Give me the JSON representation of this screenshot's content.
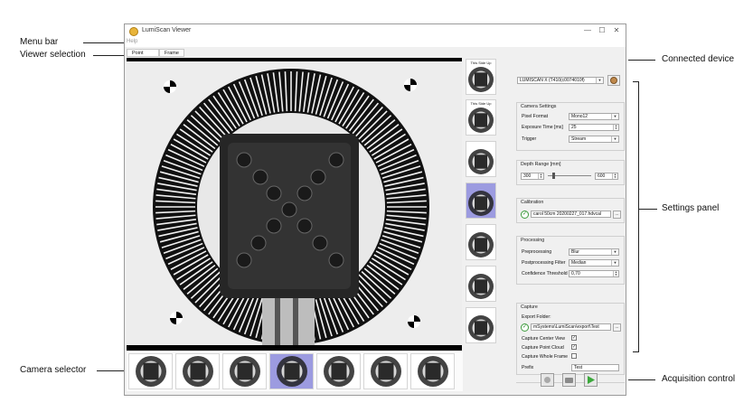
{
  "annotations": {
    "menu_bar": "Menu bar",
    "viewer_selection": "Viewer selection",
    "camera_selector": "Camera selector",
    "connected_device": "Connected device",
    "settings_panel": "Settings panel",
    "acquisition_control": "Acquisition control"
  },
  "window": {
    "title": "LumiScan Viewer",
    "controls": {
      "minimize": "—",
      "maximize": "☐",
      "close": "✕"
    }
  },
  "menu": {
    "help": "Help"
  },
  "tabs": [
    {
      "label": "Point Cloud"
    },
    {
      "label": "Frame"
    }
  ],
  "vertical_thumbs": [
    {
      "caption": "This Side Up",
      "selected": false
    },
    {
      "caption": "This Side Up",
      "selected": false
    },
    {
      "caption": "",
      "selected": false
    },
    {
      "caption": "",
      "selected": true
    },
    {
      "caption": "",
      "selected": false
    },
    {
      "caption": "",
      "selected": false
    },
    {
      "caption": "",
      "selected": false
    }
  ],
  "bottom_thumbs": [
    {
      "selected": false
    },
    {
      "selected": false
    },
    {
      "selected": false
    },
    {
      "selected": true
    },
    {
      "selected": false
    },
    {
      "selected": false
    },
    {
      "selected": false
    }
  ],
  "device": {
    "value": "LUMISCAN X (T410(c0074010f)"
  },
  "camera_settings": {
    "title": "Camera Settings",
    "pixel_format_label": "Pixel Format",
    "pixel_format_value": "Mono12",
    "exposure_label": "Exposure Time [ms]",
    "exposure_value": "25",
    "trigger_label": "Trigger",
    "trigger_value": "Stream"
  },
  "depth_range": {
    "title": "Depth Range [mm]",
    "min_value": "300",
    "max_value": "600",
    "slider_fraction": 0.12
  },
  "calibration": {
    "title": "Calibration",
    "file_value": "carol 50cm 20200227_017.hdvcal",
    "browse_label": "..."
  },
  "processing": {
    "title": "Processing",
    "preprocessing_label": "Preprocessing",
    "preprocessing_value": "Blur",
    "postprocessing_label": "Postprocessing Filter",
    "postprocessing_value": "Median",
    "confidence_label": "Confidence Threshold",
    "confidence_value": "0,70"
  },
  "capture": {
    "title": "Capture",
    "export_label": "Export Folder:",
    "export_value": "mSystems\\LumiScan\\export\\Test",
    "browse_label": "...",
    "center_view_label": "Capture Center View",
    "center_view_checked": "✓",
    "point_cloud_label": "Capture Point Cloud",
    "point_cloud_checked": "✓",
    "whole_frame_label": "Capture Whole Frame",
    "whole_frame_checked": "",
    "prefix_label": "Prefix",
    "prefix_value": "Test"
  },
  "icons": {
    "app": "app-icon",
    "device": "device-settings-icon",
    "record": "record-icon",
    "camera": "camera-icon",
    "play": "play-icon"
  },
  "colors": {
    "selection": "#9c9be0",
    "accent_green": "#2e8b2e",
    "app_orange": "#e8b43a"
  }
}
